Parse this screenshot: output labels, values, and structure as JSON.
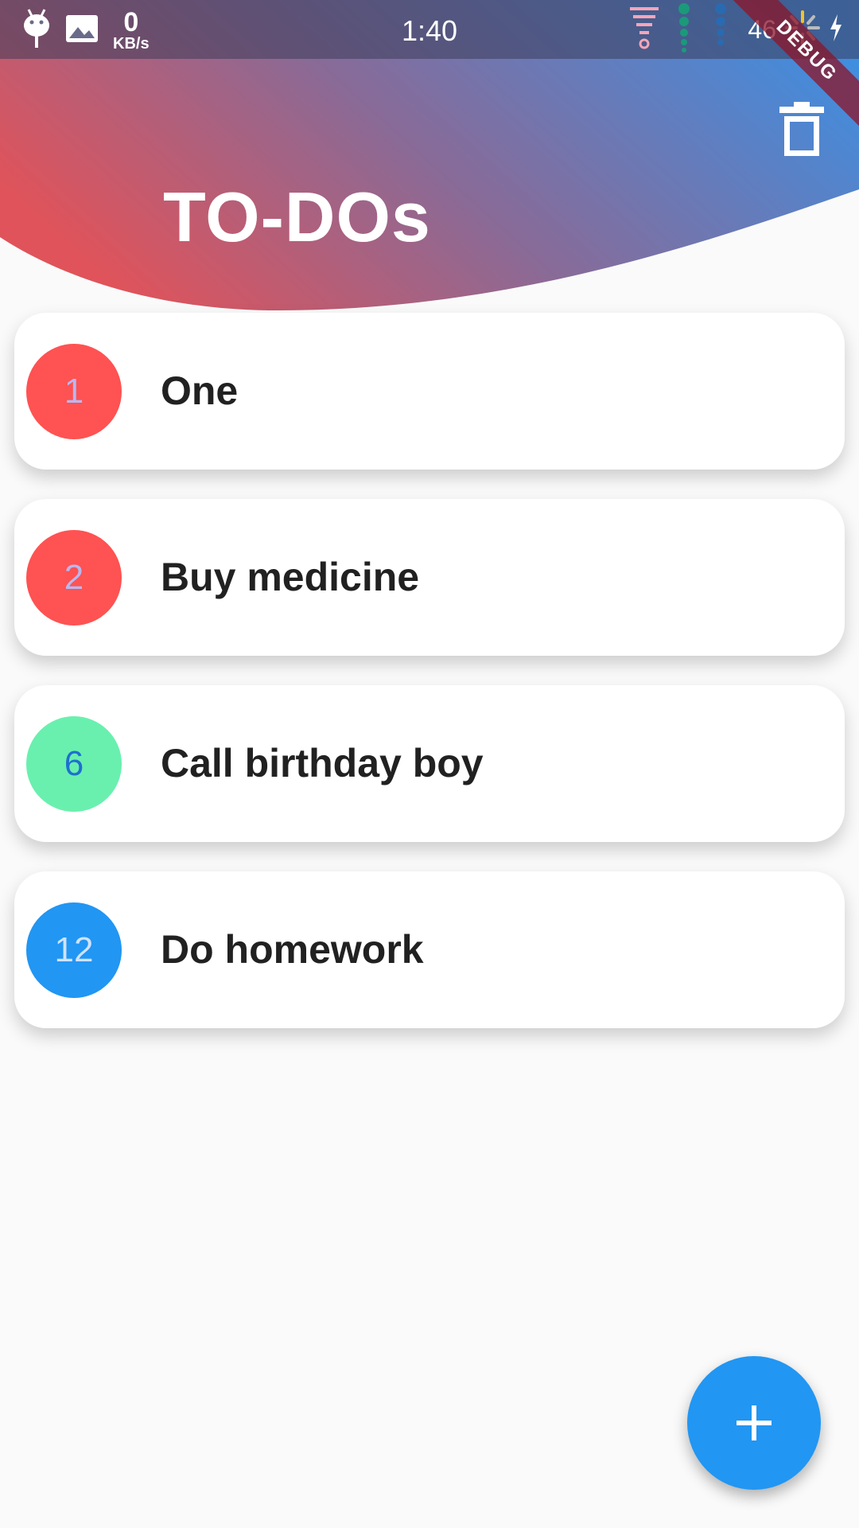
{
  "status_bar": {
    "net_speed_value": "0",
    "net_speed_unit": "KB/s",
    "time": "1:40",
    "battery": "46",
    "icons": [
      "android-debug-icon",
      "image-icon",
      "signal-icon",
      "wifi-icon",
      "loading-icon",
      "charging-icon"
    ]
  },
  "debug_banner": "DEBUG",
  "header": {
    "title": "TO-DOs",
    "gradient_start": "#e0535a",
    "gradient_end": "#3f8ee0",
    "trash_icon": "trash-icon"
  },
  "todos": [
    {
      "number": "1",
      "label": "One",
      "circle_color": "#ff5252",
      "number_color": "#b8b8f0"
    },
    {
      "number": "2",
      "label": "Buy medicine",
      "circle_color": "#ff5252",
      "number_color": "#b8b8f0"
    },
    {
      "number": "6",
      "label": "Call birthday boy",
      "circle_color": "#69f0ae",
      "number_color": "#1e6fd0"
    },
    {
      "number": "12",
      "label": "Do homework",
      "circle_color": "#2196f3",
      "number_color": "#cfe3ff"
    }
  ],
  "fab": {
    "icon": "plus-icon",
    "color": "#2196f3"
  }
}
